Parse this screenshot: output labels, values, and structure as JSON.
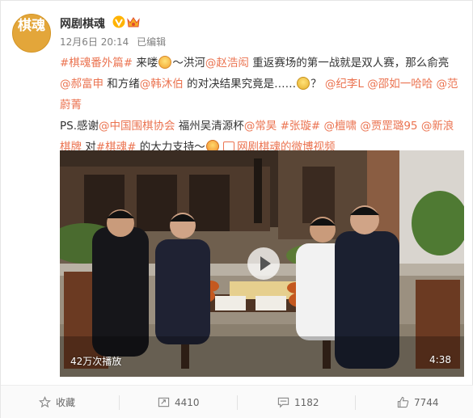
{
  "header": {
    "avatar_text": "棋魂",
    "user_name": "网剧棋魂",
    "time": "12月6日 20:14",
    "edited": "已编辑"
  },
  "post": {
    "l1_tag": "#棋魂番外篇#",
    "l1_t1": " 来喽",
    "l1_t2": "～洪河",
    "l1_at1": "@赵浩闳",
    "l1_t3": " 重返赛场的第一战就是双人赛，那么俞亮",
    "l2_at1": "@郝富申",
    "l2_t1": " 和方绪",
    "l2_at2": "@韩沐伯",
    "l2_t2": " 的对决结果究竟是……",
    "l2_t3": "？",
    "l2_at3": "@纪李L",
    "l2_at4": "@邵如一哈哈",
    "l2_at5": "@范",
    "l3_at1": "蔚菁",
    "l4_t1": "PS.感谢",
    "l4_at1": "@中国围棋协会",
    "l4_t2": " 福州吴清源杯",
    "l4_at2": "@常昊",
    "l4_tag1": "#张璇#",
    "l4_at3": "@檀啸",
    "l4_at4": "@贾罡璐95",
    "l4_at5": "@新浪",
    "l5_at1": "棋牌",
    "l5_t1": " 对",
    "l5_tag1": "#棋魂#",
    "l5_t2": " 的大力支持～",
    "l5_link": "网剧棋魂的微博视频"
  },
  "video": {
    "views": "42万次播放",
    "duration": "4:38"
  },
  "actions": {
    "favorite": "收藏",
    "repost": "4410",
    "comment": "1182",
    "like": "7744"
  },
  "colors": {
    "link": "#eb7350",
    "avatar": "#e3a63a",
    "meta": "#808080"
  }
}
